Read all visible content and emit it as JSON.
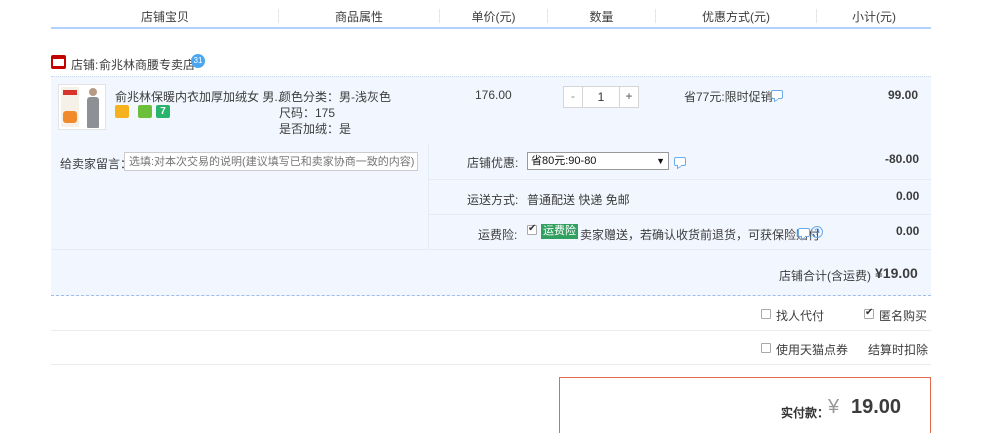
{
  "header": {
    "columns": [
      "店铺宝贝",
      "商品属性",
      "单价(元)",
      "数量",
      "优惠方式(元)",
      "小计(元)"
    ]
  },
  "shop": {
    "label": "店铺:",
    "name": "俞兆林商腰专卖店",
    "ww_badge": "31"
  },
  "item": {
    "title": "俞兆林保暖内衣加厚加绒女 男...",
    "attrs": [
      "颜色分类：男-浅灰色",
      "尺码：175",
      "是否加绒：是"
    ],
    "price": "176.00",
    "qty_minus": "-",
    "qty": "1",
    "qty_plus": "+",
    "promo": "省77元:限时促销",
    "subtotal": "99.00",
    "badge_last": "7"
  },
  "message": {
    "label": "给卖家留言：",
    "placeholder": "选填:对本次交易的说明(建议填写已和卖家协商一致的内容)"
  },
  "shop_discount": {
    "label": "店铺优惠:",
    "selected": "省80元:90-80",
    "arrow": "▼",
    "amount": "-80.00"
  },
  "shipping": {
    "label": "运送方式:",
    "value": "普通配送 快递 免邮",
    "amount": "0.00"
  },
  "insurance": {
    "label": "运费险:",
    "tag": "运费险",
    "text": "卖家赠送，若确认收货前退货，可获保险赔付",
    "help": "?",
    "amount": "0.00"
  },
  "shop_total": {
    "label": "店铺合计(含运费)",
    "value": "¥19.00"
  },
  "options": {
    "proxy_pay": "找人代付",
    "anonymous": "匿名购买",
    "coupon": "使用天猫点券",
    "deduct": "结算时扣除"
  },
  "pay": {
    "label": "实付款：",
    "currency": "¥",
    "amount": "19.00"
  },
  "colors": {
    "accent_blue": "#b2d1ff",
    "price_red": "#c40000",
    "row_bg": "#f2f7ff",
    "tag_green": "#32a05f"
  }
}
